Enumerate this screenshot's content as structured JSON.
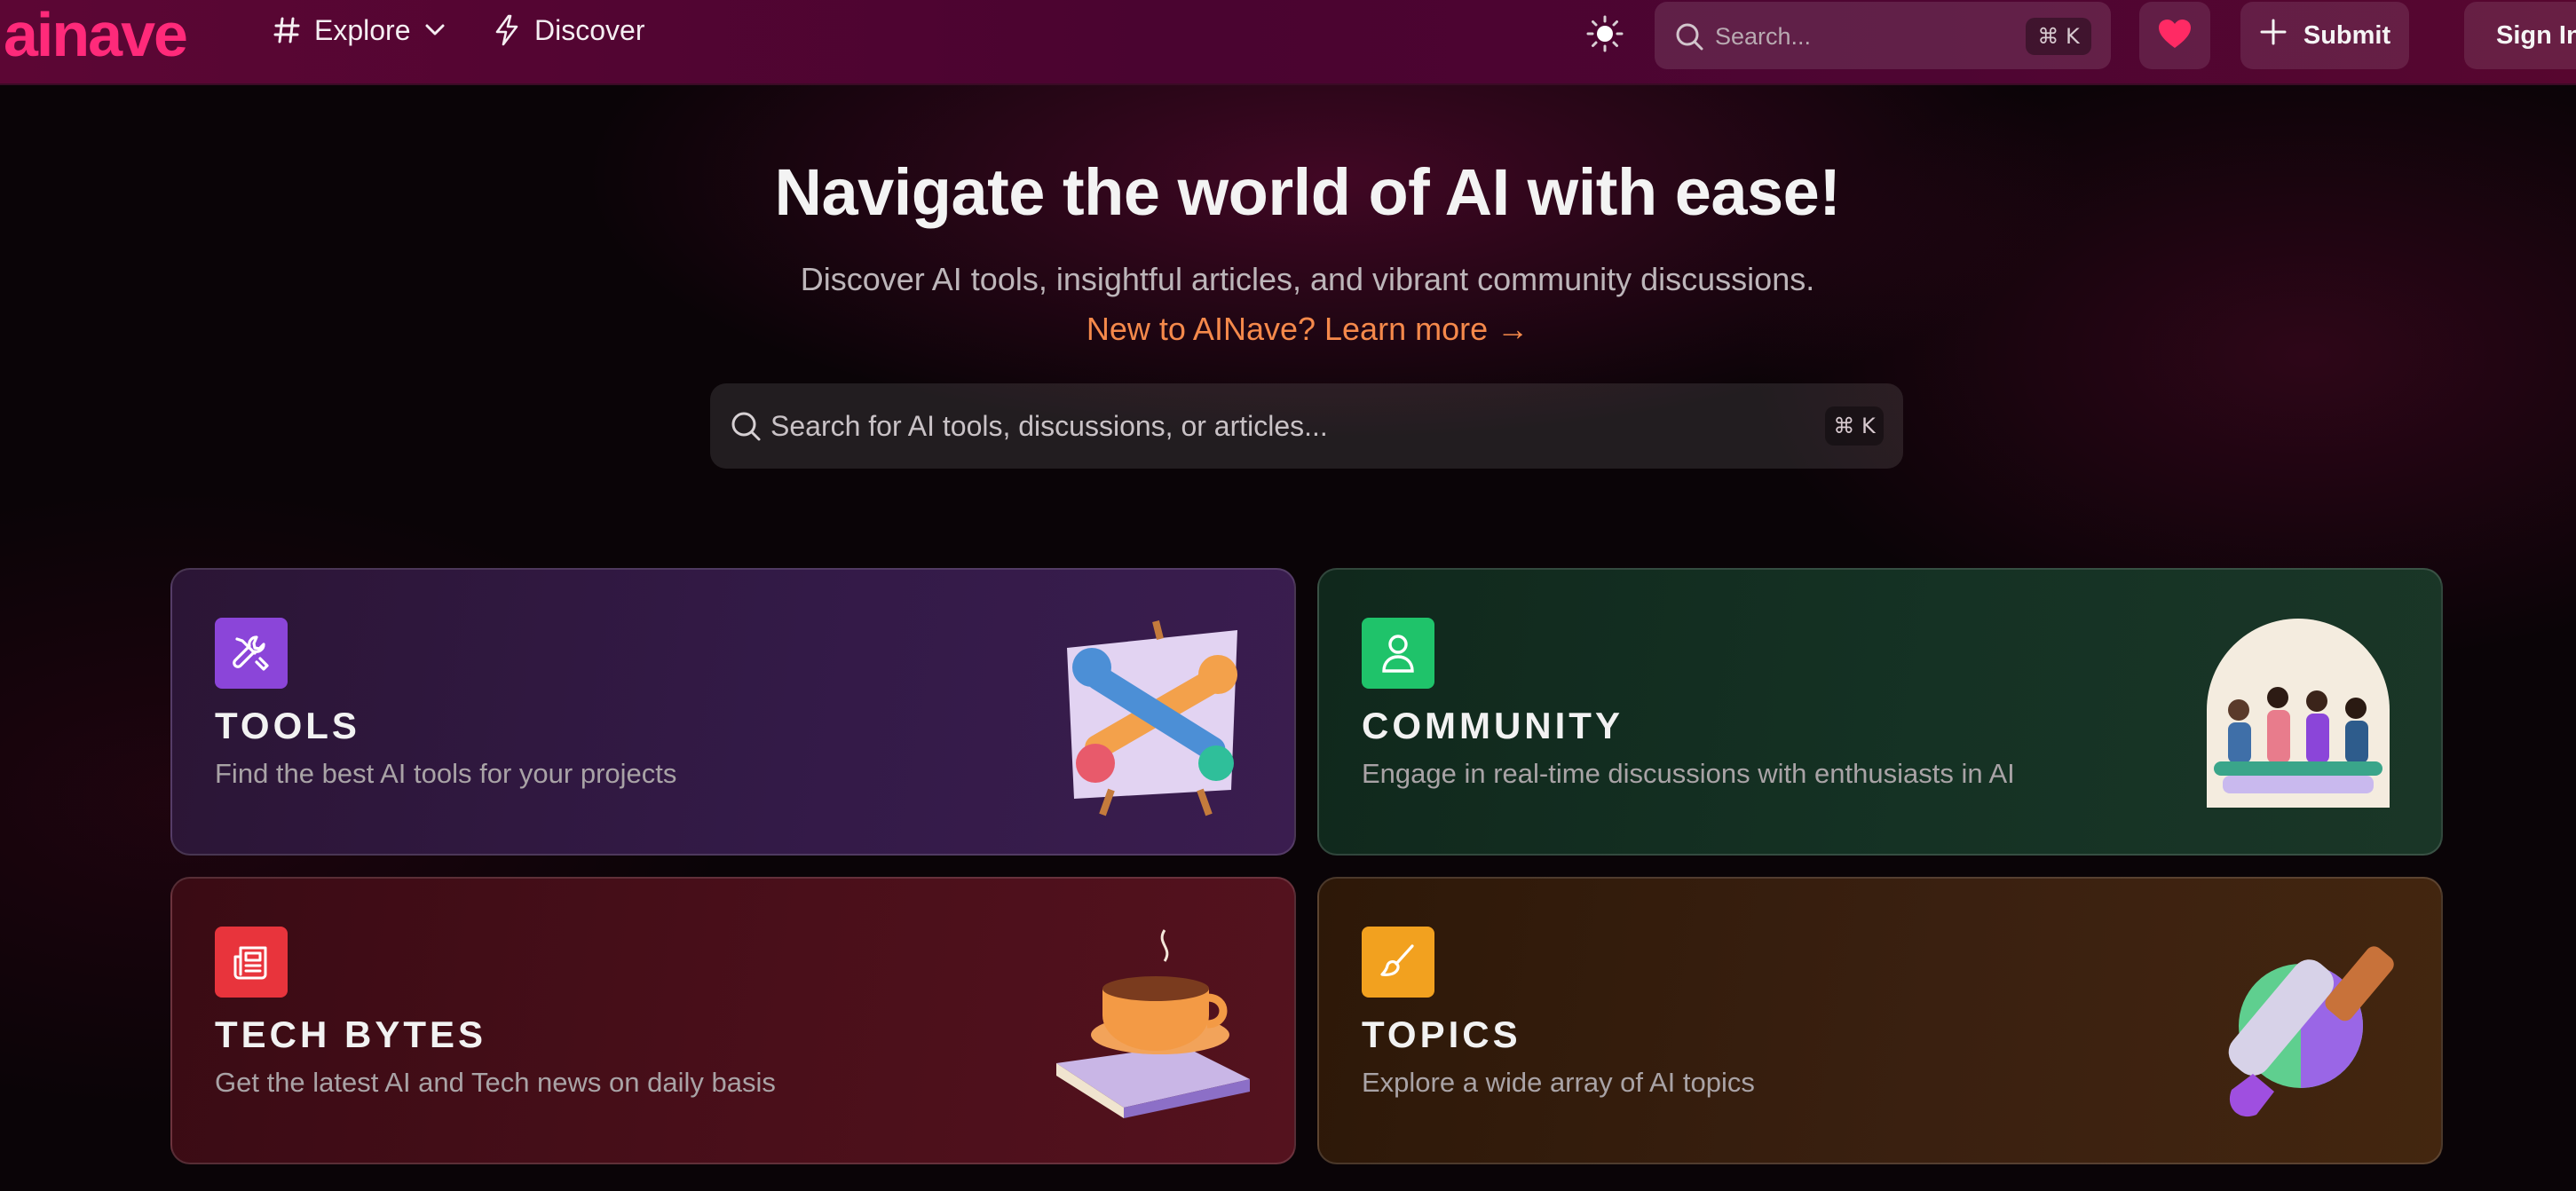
{
  "header": {
    "logo": "ainave",
    "nav": [
      {
        "label": "Explore",
        "icon": "hash-icon",
        "has_dropdown": true
      },
      {
        "label": "Discover",
        "icon": "lightning-icon"
      }
    ],
    "search": {
      "placeholder": "Search...",
      "shortcut": "⌘ K"
    },
    "submit_label": "Submit",
    "signin_label": "Sign In"
  },
  "hero": {
    "title": "Navigate the world of AI with ease!",
    "subtitle": "Discover AI tools, insightful articles, and vibrant community discussions.",
    "learn_more": "New to AINave? Learn more →",
    "search": {
      "placeholder": "Search for AI tools, discussions, or articles...",
      "shortcut": "⌘ K"
    }
  },
  "cards": [
    {
      "title": "TOOLS",
      "description": "Find the best AI tools for your projects",
      "icon": "tools-icon",
      "accent": "#8b45d9"
    },
    {
      "title": "COMMUNITY",
      "description": "Engage in real-time discussions with enthusiasts in AI",
      "icon": "user-icon",
      "accent": "#1fc36a"
    },
    {
      "title": "TECH BYTES",
      "description": "Get the latest AI and Tech news on daily basis",
      "icon": "newspaper-icon",
      "accent": "#e8343c"
    },
    {
      "title": "TOPICS",
      "description": "Explore a wide array of AI topics",
      "icon": "brush-icon",
      "accent": "#f2a11f"
    }
  ],
  "colors": {
    "brand": "#ff2a7a",
    "header_bg": "#4e0532",
    "learn_more": "#f5894b"
  }
}
